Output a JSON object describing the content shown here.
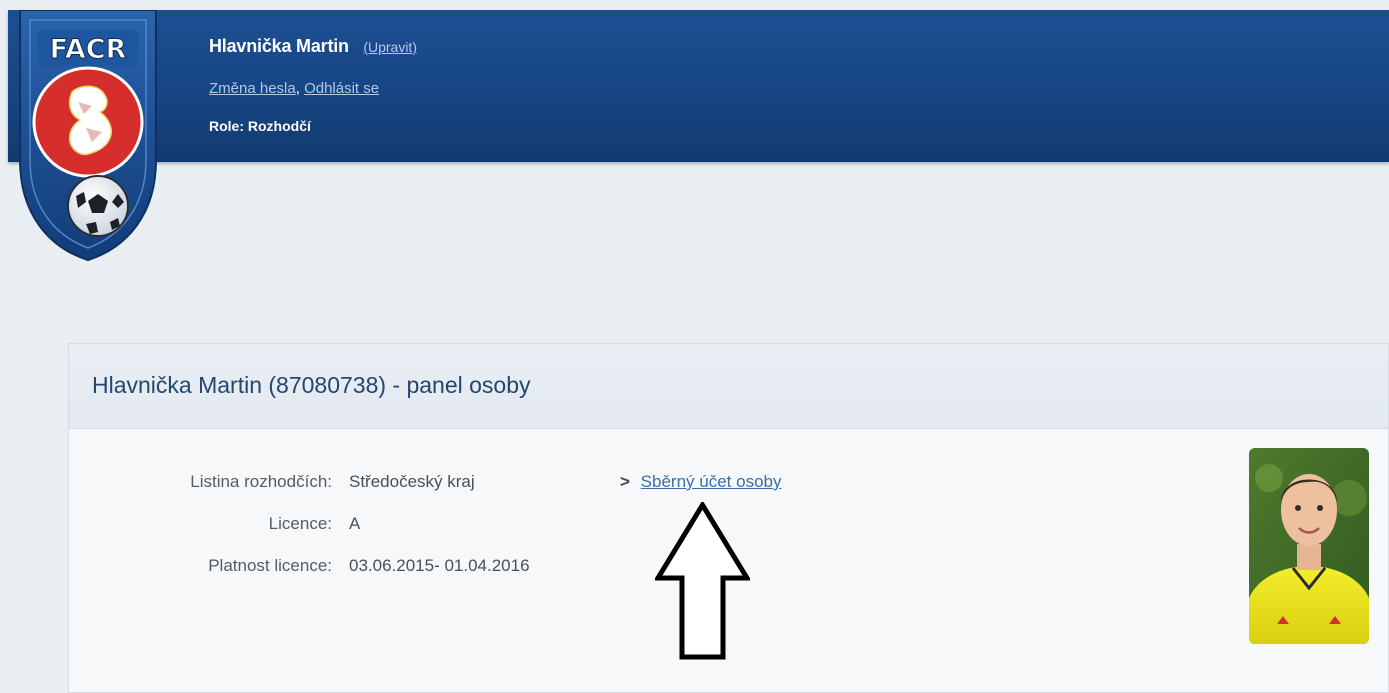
{
  "header": {
    "user_name": "Hlavnička Martin",
    "edit_label": "(Upravit)",
    "change_password_label": "Změna hesla",
    "separator": ",",
    "logout_label": "Odhlásit se",
    "role_text": "Role: Rozhodčí",
    "logo_text": "FACR"
  },
  "panel": {
    "title": "Hlavnička Martin (87080738) - panel osoby",
    "fields": [
      {
        "label": "Listina rozhodčích:",
        "value": "Středočeský kraj"
      },
      {
        "label": "Licence:",
        "value": "A"
      },
      {
        "label": "Platnost licence:",
        "value": "03.06.2015- 01.04.2016"
      }
    ],
    "account_link_chevron": ">",
    "account_link_label": "Sběrný účet osoby"
  },
  "icons": {
    "logo": "facr-logo-icon",
    "chevron": "chevron-right-icon",
    "arrow": "arrow-up-icon",
    "photo": "person-photo"
  },
  "colors": {
    "header_blue": "#174584",
    "link_blue": "#3b6ea8",
    "panel_title": "#23476f",
    "background": "#e9eef3"
  }
}
